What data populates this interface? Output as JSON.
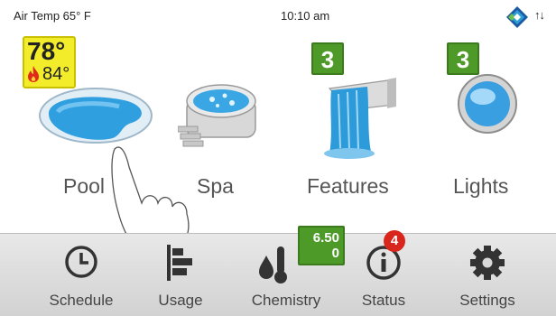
{
  "status_bar": {
    "air_temp": "Air Temp 65° F",
    "time": "10:10 am",
    "connection_arrows": "↑↓"
  },
  "tiles": [
    {
      "label": "Pool",
      "temp": "78°",
      "heater_temp": "84°"
    },
    {
      "label": "Spa"
    },
    {
      "label": "Features",
      "count": "3"
    },
    {
      "label": "Lights",
      "count": "3"
    }
  ],
  "nav": [
    {
      "label": "Schedule",
      "icon": "clock-icon"
    },
    {
      "label": "Usage",
      "icon": "bar-chart-icon"
    },
    {
      "label": "Chemistry",
      "icon": "water-drop-thermometer-icon",
      "badge_line1": "6.50",
      "badge_line2": "0"
    },
    {
      "label": "Status",
      "icon": "info-icon",
      "alert_count": "4"
    },
    {
      "label": "Settings",
      "icon": "gear-icon"
    }
  ],
  "colors": {
    "temp_badge": "#f2ec2a",
    "count_badge": "#4e9a29",
    "alert_badge": "#d9261c",
    "nav_bar": "#dcdcdc"
  }
}
